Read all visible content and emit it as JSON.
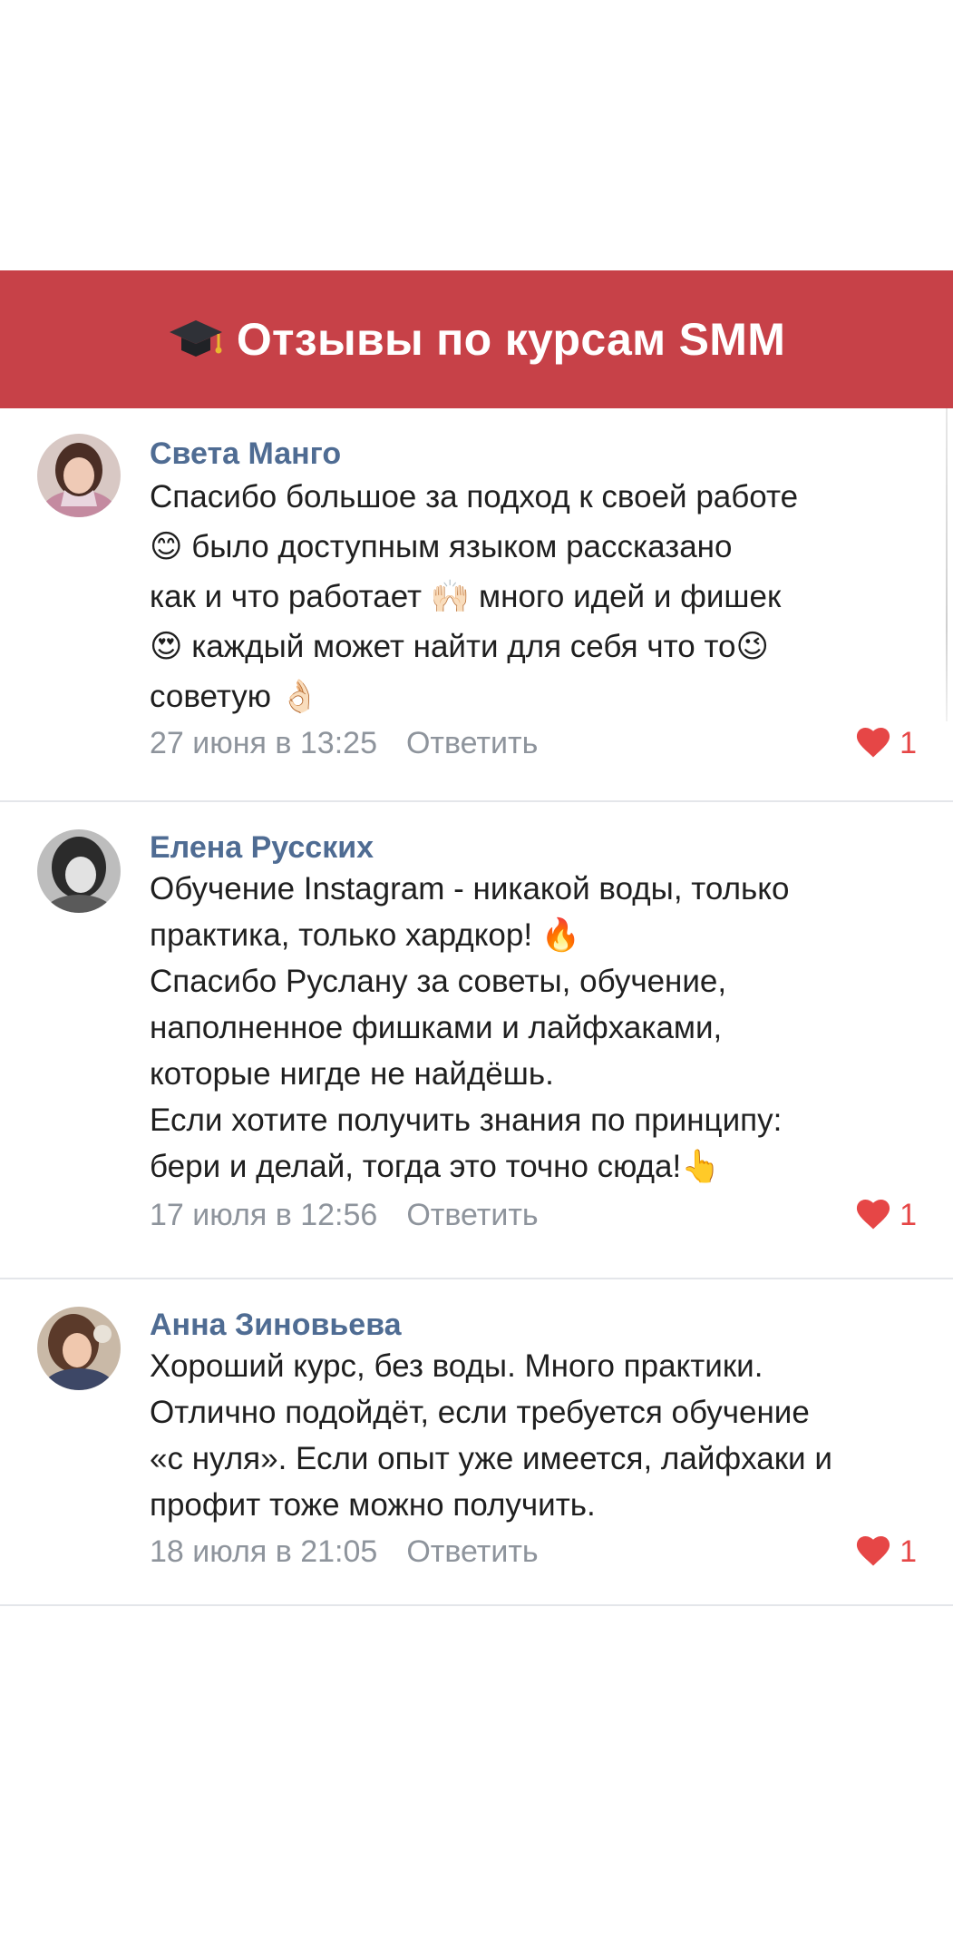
{
  "banner": {
    "icon": "graduation-cap-icon",
    "title": "Отзывы по курсам SMM",
    "background": "#c74148"
  },
  "colors": {
    "author": "#4f6c93",
    "meta": "#8e949c",
    "like": "#e64646",
    "divider": "#e4e6ea"
  },
  "comments": [
    {
      "author": "Света Манго",
      "text": "Спасибо большое за подход к своей работе\n😊 было доступным языком рассказано\nкак и что работает 🙌🏻 много идей и фишек\n😍 каждый может найти для себя что то😉\nсоветую 👌🏻",
      "date": "27 июня в 13:25",
      "reply_label": "Ответить",
      "likes": "1"
    },
    {
      "author": "Елена Русских",
      "text": "Обучение Instagram - никакой воды, только\nпрактика, только хардкор! 🔥\nСпасибо Руслану за советы, обучение,\nнаполненное фишками и лайфхаками,\nкоторые нигде не найдёшь.\nЕсли хотите получить знания по принципу:\nбери и делай, тогда это точно сюда!👆",
      "date": "17 июля в 12:56",
      "reply_label": "Ответить",
      "likes": "1"
    },
    {
      "author": "Анна Зиновьева",
      "text": "Хороший курс, без воды. Много практики.\nОтлично подойдёт, если требуется обучение\n«с нуля». Если опыт уже имеется, лайфхаки и\nпрофит тоже можно получить.",
      "date": "18 июля в 21:05",
      "reply_label": "Ответить",
      "likes": "1"
    }
  ]
}
